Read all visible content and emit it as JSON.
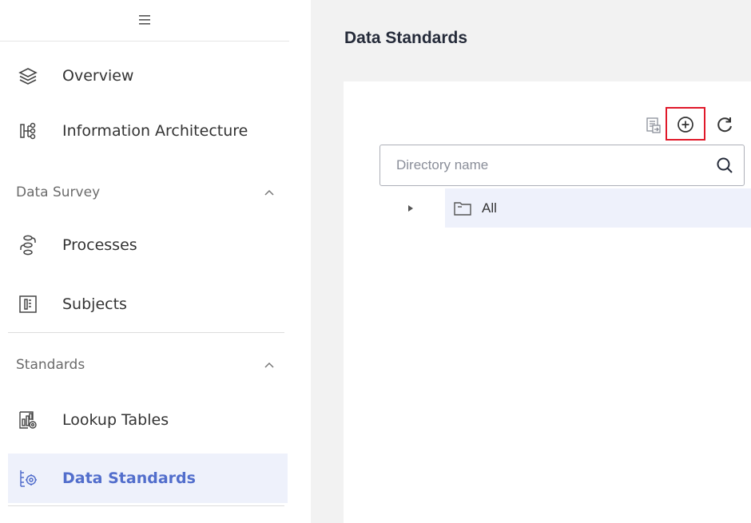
{
  "sidebar": {
    "toggle_icon": "menu-collapse-icon",
    "items": [
      {
        "label": "Overview",
        "icon": "layers-icon"
      },
      {
        "label": "Information Architecture",
        "icon": "architecture-icon"
      },
      {
        "label": "Processes",
        "icon": "processes-icon"
      },
      {
        "label": "Subjects",
        "icon": "subjects-icon"
      },
      {
        "label": "Lookup Tables",
        "icon": "lookup-tables-icon"
      },
      {
        "label": "Data Standards",
        "icon": "data-standards-icon",
        "active": true
      }
    ],
    "groups": [
      {
        "label": "Data Survey",
        "expanded": true
      },
      {
        "label": "Standards",
        "expanded": true
      }
    ]
  },
  "main": {
    "title": "Data Standards",
    "toolbar": {
      "icons": [
        "import-icon",
        "add-icon",
        "refresh-icon"
      ]
    },
    "search": {
      "placeholder": "Directory name",
      "value": ""
    },
    "tree": {
      "root_label": "All",
      "collapsed": true
    }
  },
  "colors": {
    "accent": "#526ecc",
    "active_bg": "#eef1fb",
    "main_bg": "#f2f2f2",
    "highlight_border": "#e0192a"
  }
}
